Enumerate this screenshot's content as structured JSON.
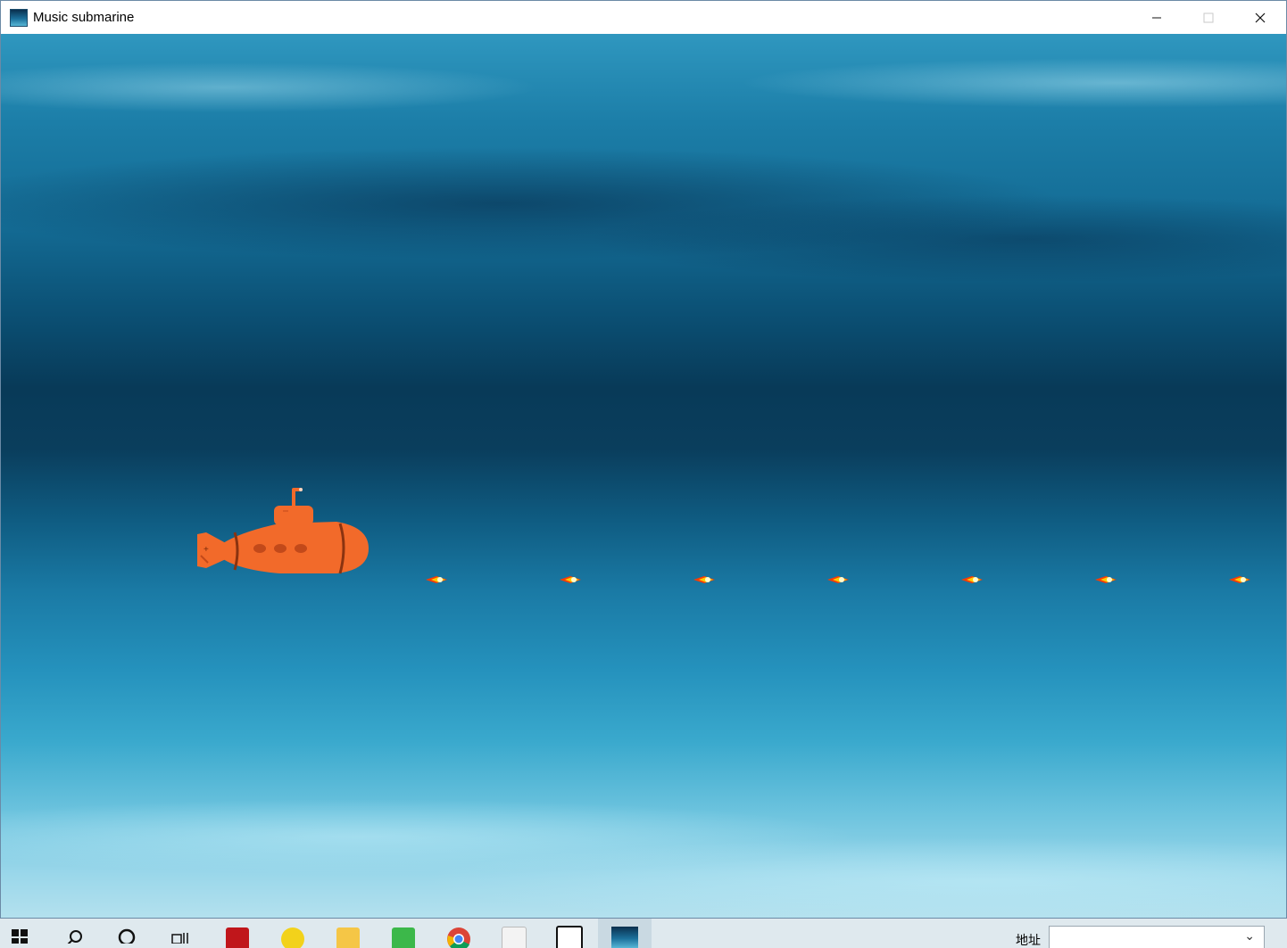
{
  "window": {
    "title": "Music submarine",
    "icon": "app-ocean-icon",
    "controls": {
      "minimize": "—",
      "maximize": "☐",
      "close": "✕"
    }
  },
  "game": {
    "background": "underwater-ocean",
    "player": {
      "type": "submarine",
      "color": "#f26a2a"
    },
    "bullets_count": 7,
    "bullet_icon": "fire-bullet-icon"
  },
  "taskbar": {
    "apps": [
      "windows-start-icon",
      "search-icon",
      "cortana-circle-icon",
      "task-view-icon",
      "acrobat-icon",
      "app-yellow-icon",
      "file-explorer-icon",
      "qc-app-icon",
      "chrome-icon",
      "typora-icon",
      "dice-app-icon",
      "music-submarine-app-icon"
    ],
    "address_label": "地址",
    "address_value": ""
  },
  "colors": {
    "submarine": "#f26a2a",
    "submarine_dark": "#c2491a",
    "ocean_top": "#2f97bf",
    "ocean_deep": "#083a58",
    "ocean_bottom": "#b4e1ee"
  }
}
